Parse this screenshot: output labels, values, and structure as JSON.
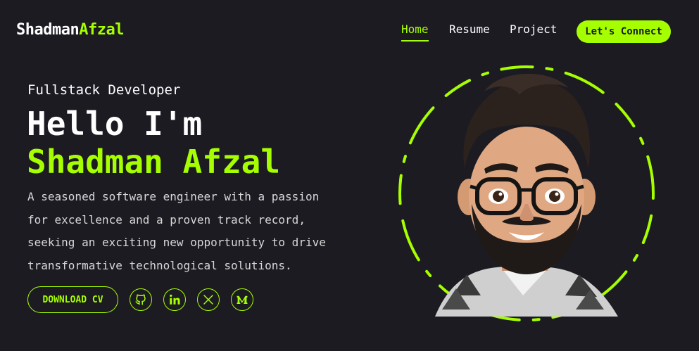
{
  "header": {
    "logo_first": "Shadman",
    "logo_second": "Afzal",
    "nav": [
      {
        "label": "Home",
        "active": true
      },
      {
        "label": "Resume",
        "active": false
      },
      {
        "label": "Project",
        "active": false
      }
    ],
    "cta_label": "Let's Connect"
  },
  "hero": {
    "role": "Fullstack Developer",
    "greeting": "Hello I'm",
    "name": "Shadman Afzal",
    "description": "A seasoned software engineer with a passion for excellence and a proven track record, seeking an exciting new opportunity to drive transformative technological solutions.",
    "cv_label": "DOWNLOAD CV"
  },
  "social": [
    {
      "icon": "github-icon"
    },
    {
      "icon": "linkedin-icon"
    },
    {
      "icon": "x-icon"
    },
    {
      "icon": "medium-icon"
    }
  ],
  "colors": {
    "background": "#1c1b22",
    "accent": "#a6ff00",
    "text": "#ffffff",
    "muted_text": "#d8d8d8"
  }
}
